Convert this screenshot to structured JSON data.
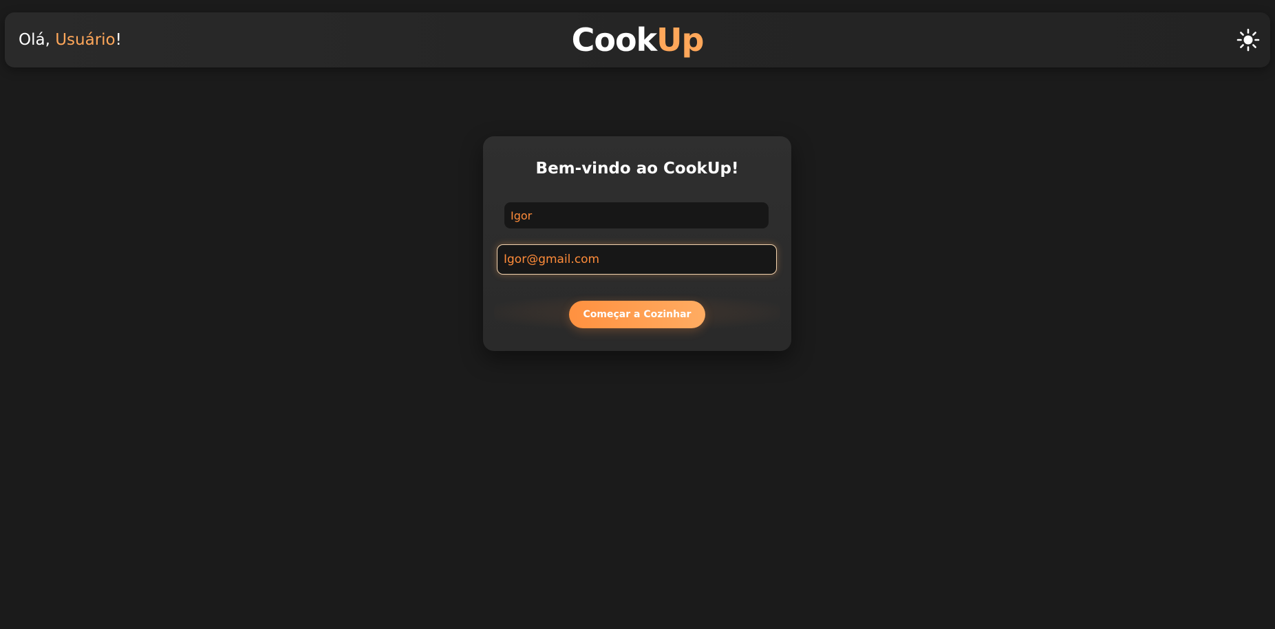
{
  "header": {
    "greeting_prefix": "Olá, ",
    "greeting_name": "Usuário",
    "greeting_suffix": "!",
    "brand_part1": "Cook",
    "brand_part2": "Up",
    "theme_toggle_icon": "sun-icon"
  },
  "login_card": {
    "title": "Bem-vindo ao CookUp!",
    "name_field_value": "Igor",
    "email_field_value": "Igor@gmail.com",
    "submit_label": "Começar a Cozinhar"
  },
  "colors": {
    "background": "#1b1b1b",
    "accent": "#ffa75a",
    "input_text": "#ff8c3a",
    "button_gradient_start": "#ff9140",
    "button_gradient_end": "#ffac62"
  }
}
